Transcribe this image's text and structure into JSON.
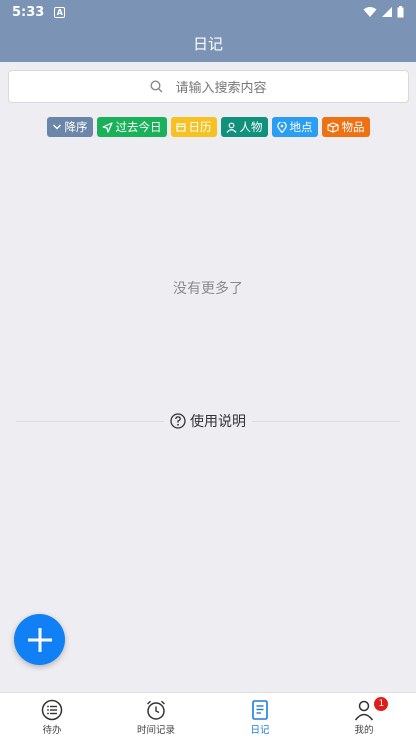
{
  "status_bar": {
    "time": "5:33",
    "notif_letter": "A"
  },
  "header": {
    "title": "日记"
  },
  "search": {
    "placeholder": "请输入搜索内容"
  },
  "filters": [
    {
      "label": "降序",
      "icon": "chevron-down-icon",
      "color": "#6b86a8"
    },
    {
      "label": "过去今日",
      "icon": "send-icon",
      "color": "#1ab15a"
    },
    {
      "label": "日历",
      "icon": "calendar-icon",
      "color": "#f6c223"
    },
    {
      "label": "人物",
      "icon": "person-icon",
      "color": "#11907c"
    },
    {
      "label": "地点",
      "icon": "location-icon",
      "color": "#2a9ef2"
    },
    {
      "label": "物品",
      "icon": "box-icon",
      "color": "#ee7214"
    }
  ],
  "empty_text": "没有更多了",
  "help": {
    "label": "使用说明"
  },
  "tabbar": [
    {
      "label": "待办",
      "icon": "list-icon",
      "active": false
    },
    {
      "label": "时间记录",
      "icon": "alarm-icon",
      "active": false
    },
    {
      "label": "日记",
      "icon": "document-icon",
      "active": true
    },
    {
      "label": "我的",
      "icon": "user-icon",
      "active": false,
      "badge": "1"
    }
  ],
  "colors": {
    "header": "#7b94b6",
    "background": "#eeedf2",
    "accent": "#1180f4",
    "badge": "#e01d1d"
  }
}
